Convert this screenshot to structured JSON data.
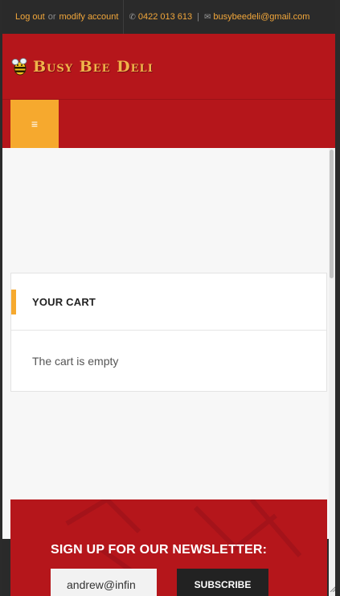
{
  "topbar": {
    "logout_label": "Log out",
    "or_text": "or",
    "modify_label": "modify account",
    "phone": "0422 013 613",
    "separator": "|",
    "email": "busybeedeli@gmail.com",
    "phone_icon": "phone-icon",
    "email_icon": "envelope-icon"
  },
  "header": {
    "logo_text": "Busy Bee Deli",
    "logo_icon": "bee-icon"
  },
  "nav": {
    "menu_icon": "hamburger-menu-icon",
    "menu_glyph": "≡"
  },
  "cart": {
    "title": "YOUR CART",
    "empty_message": "The cart is empty"
  },
  "newsletter": {
    "title": "SIGN UP FOR OUR NEWSLETTER:",
    "email_value": "andrew@infin",
    "subscribe_label": "SUBSCRIBE"
  },
  "colors": {
    "brand_red": "#b5161b",
    "accent_orange": "#f6a92e",
    "dark": "#2a2a2a",
    "logo_gold": "#f0b44a"
  }
}
